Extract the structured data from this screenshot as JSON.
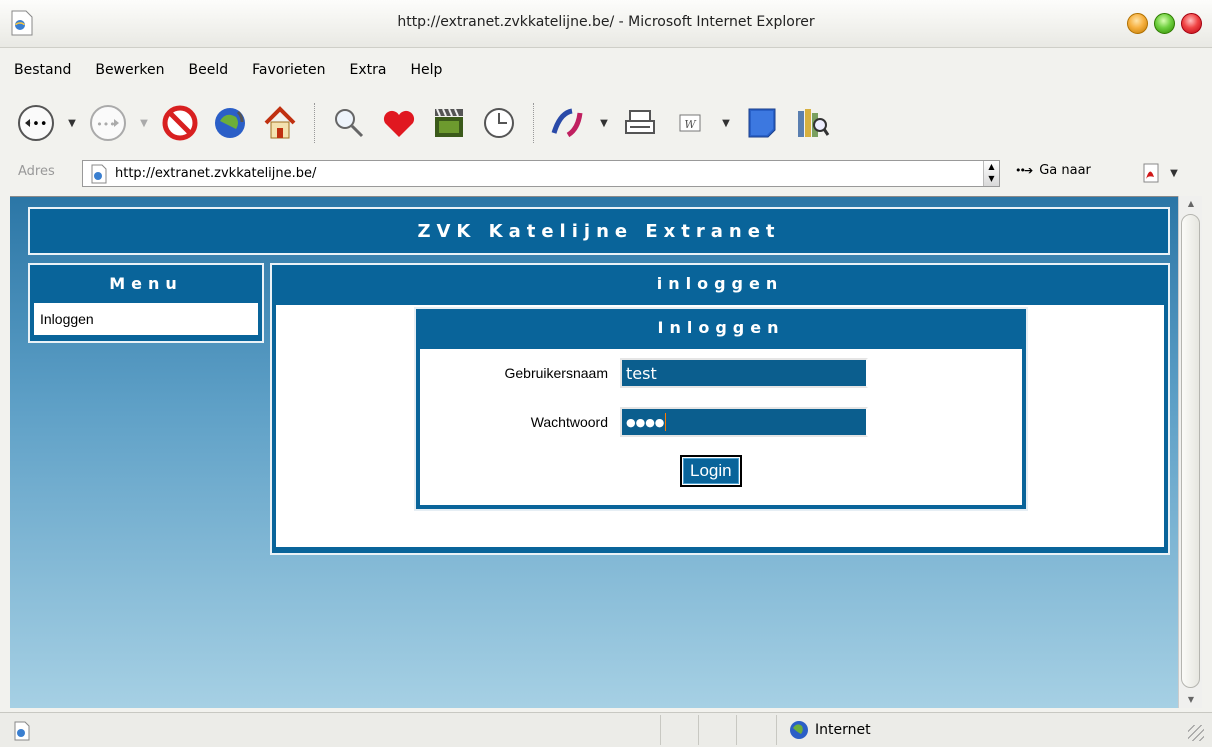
{
  "window": {
    "title": "http://extranet.zvkkatelijne.be/ - Microsoft Internet Explorer"
  },
  "menubar": {
    "items": [
      {
        "label": "Bestand"
      },
      {
        "label": "Bewerken"
      },
      {
        "label": "Beeld"
      },
      {
        "label": "Favorieten"
      },
      {
        "label": "Extra"
      },
      {
        "label": "Help"
      }
    ]
  },
  "toolbar": {
    "icons": [
      "back-icon",
      "forward-icon",
      "stop-icon",
      "refresh-icon",
      "home-icon",
      "search-icon",
      "favorites-icon",
      "media-icon",
      "history-icon",
      "mail-icon",
      "print-icon",
      "edit-icon",
      "discuss-icon",
      "research-icon"
    ]
  },
  "address": {
    "label": "Adres",
    "url": "http://extranet.zvkkatelijne.be/",
    "go_label": "Ga naar"
  },
  "page": {
    "banner": "ZVK Katelijne Extranet",
    "menu": {
      "header": "Menu",
      "items": [
        {
          "label": "Inloggen"
        }
      ]
    },
    "content_header": "inloggen",
    "login": {
      "header": "Inloggen",
      "username_label": "Gebruikersnaam",
      "username_value": "test",
      "password_label": "Wachtwoord",
      "password_mask": "●●●●",
      "button_label": "Login"
    }
  },
  "status": {
    "zone": "Internet"
  },
  "colors": {
    "panel_blue": "#09649a",
    "gradient_top": "#2b76a6",
    "gradient_bottom": "#a6d0e4"
  }
}
